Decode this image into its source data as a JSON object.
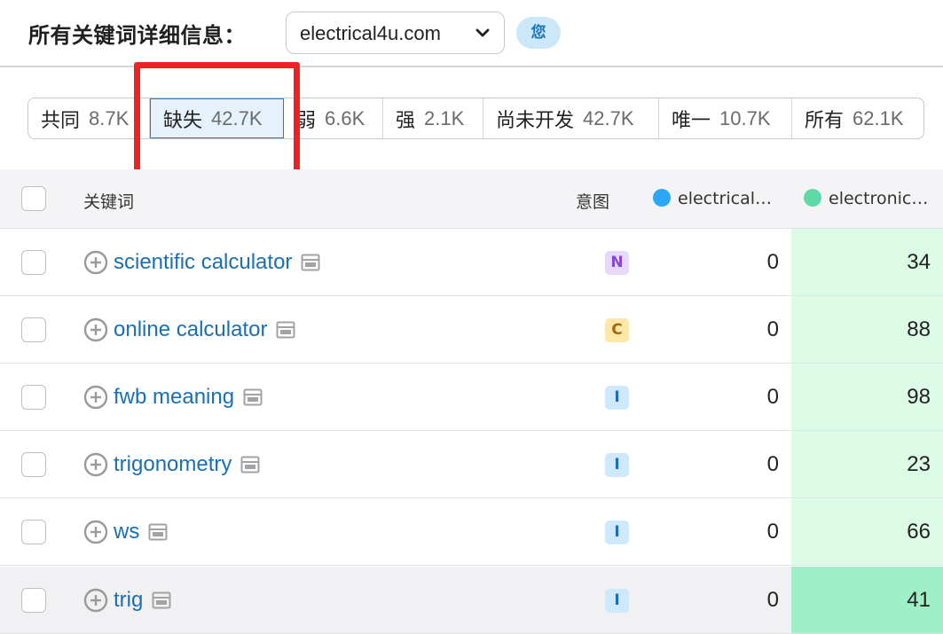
{
  "header": {
    "title": "所有关键词详细信息：",
    "domain": "electrical4u.com",
    "you_badge": "您"
  },
  "filter_tabs": [
    {
      "label": "共同",
      "count": "8.7K",
      "active": false
    },
    {
      "label": "缺失",
      "count": "42.7K",
      "active": true
    },
    {
      "label": "弱",
      "count": "6.6K",
      "active": false
    },
    {
      "label": "强",
      "count": "2.1K",
      "active": false
    },
    {
      "label": "尚未开发",
      "count": "42.7K",
      "active": false
    },
    {
      "label": "唯一",
      "count": "10.7K",
      "active": false
    },
    {
      "label": "所有",
      "count": "62.1K",
      "active": false
    }
  ],
  "table": {
    "columns": {
      "keyword": "关键词",
      "intent": "意图",
      "domain1": "electrical…",
      "domain2": "electronic…"
    },
    "colors": {
      "domain1": "#2aa8f5",
      "domain2": "#5fd9a8",
      "highlight": "#ee2222"
    },
    "rows": [
      {
        "keyword": "scientific calculator",
        "intent": "N",
        "v1": "0",
        "v2": "34"
      },
      {
        "keyword": "online calculator",
        "intent": "C",
        "v1": "0",
        "v2": "88"
      },
      {
        "keyword": "fwb meaning",
        "intent": "I",
        "v1": "0",
        "v2": "98"
      },
      {
        "keyword": "trigonometry",
        "intent": "I",
        "v1": "0",
        "v2": "23"
      },
      {
        "keyword": "ws",
        "intent": "I",
        "v1": "0",
        "v2": "66"
      },
      {
        "keyword": "trig",
        "intent": "I",
        "v1": "0",
        "v2": "41"
      }
    ]
  }
}
